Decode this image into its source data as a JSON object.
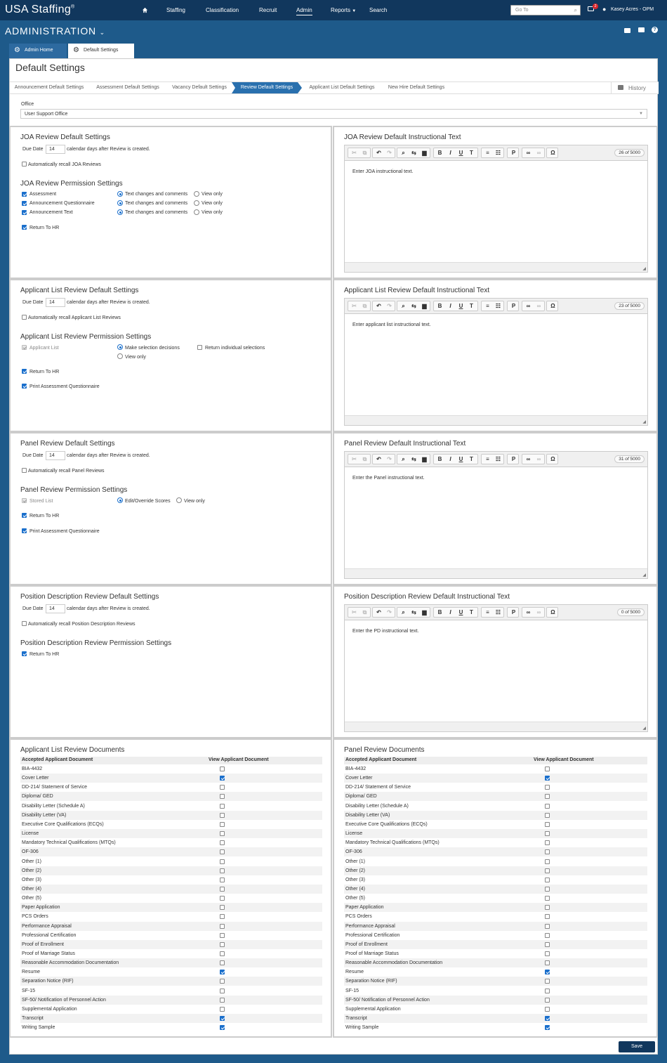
{
  "topnav": {
    "brand": "USA Staffing",
    "brand_mark": "®",
    "items": [
      "Staffing",
      "Classification",
      "Recruit",
      "Admin",
      "Reports",
      "Search"
    ],
    "goto_placeholder": "Go To",
    "notify_count": "2",
    "user": "Kasey Acres - OPM"
  },
  "admin": {
    "title": "ADMINISTRATION"
  },
  "tabs": [
    "Admin Home",
    "Default Settings"
  ],
  "page": {
    "title": "Default Settings"
  },
  "breadcrumbs": [
    "Announcement Default Settings",
    "Assessment Default Settings",
    "Vacancy Default Settings",
    "Review Default Settings",
    "Applicant List Default Settings",
    "New Hire Default Settings"
  ],
  "history_label": "History",
  "office": {
    "label": "Office",
    "value": "User Support Office"
  },
  "common": {
    "due_date": "Due Date",
    "days_after": "calendar days after Review is created.",
    "text_changes": "Text changes and comments",
    "view_only": "View only",
    "return_to_hr": "Return To HR",
    "print_aq": "Print Assessment Questionnaire"
  },
  "joa": {
    "title": "JOA Review Default Settings",
    "days": "14",
    "recall": "Automatically recall JOA Reviews",
    "perm_title": "JOA Review Permission Settings",
    "perm_items": [
      "Assessment",
      "Announcement Questionnaire",
      "Announcement Text"
    ],
    "text_title": "JOA Review Default Instructional Text",
    "count": "26",
    "max": "5000",
    "text": "Enter JOA instructional text."
  },
  "applist": {
    "title": "Applicant List Review Default Settings",
    "days": "14",
    "recall": "Automatically recall Applicant List Reviews",
    "perm_title": "Applicant List Review Permission Settings",
    "perm_item": "Applicant List",
    "make_selection": "Make selection decisions",
    "return_individual": "Return individual selections",
    "view_only": "View only",
    "text_title": "Applicant List Review Default Instructional Text",
    "count": "23",
    "max": "5000",
    "text": "Enter applicant list instructional text."
  },
  "panel": {
    "title": "Panel Review Default Settings",
    "days": "14",
    "recall": "Automatically recall Panel Reviews",
    "perm_title": "Panel Review Permission Settings",
    "perm_item": "Stored List",
    "edit_override": "Edit/Override Scores",
    "view_only": "View only",
    "text_title": "Panel Review Default Instructional Text",
    "count": "31",
    "max": "5000",
    "text": "Enter the Panel instructional text."
  },
  "pd": {
    "title": "Position Description Review Default Settings",
    "days": "14",
    "recall": "Automatically recall Position Description Reviews",
    "perm_title": "Position Description Review Permission Settings",
    "text_title": "Position Description Review Default Instructional Text",
    "count": "0",
    "max": "5000",
    "text": "Enter the PD instructional text."
  },
  "docs": {
    "applist_title": "Applicant List Review Documents",
    "panel_title": "Panel Review Documents",
    "col_accepted": "Accepted Applicant Document",
    "col_view": "View Applicant Document",
    "items": [
      "BIA-4432",
      "Cover Letter",
      "DD-214/ Statement of Service",
      "Diploma/ GED",
      "Disability Letter (Schedule A)",
      "Disability Letter (VA)",
      "Executive Core Qualifications (ECQs)",
      "License",
      "Mandatory Technical Qualifications (MTQs)",
      "OF-306",
      "Other (1)",
      "Other (2)",
      "Other (3)",
      "Other (4)",
      "Other (5)",
      "Paper Application",
      "PCS Orders",
      "Performance Appraisal",
      "Professional Certification",
      "Proof of Enrollment",
      "Proof of Marriage Status",
      "Reasonable Accommodation Documentation",
      "Resume",
      "Separation Notice (RIF)",
      "SF-15",
      "SF-50/ Notification of Personnel Action",
      "Supplemental Application",
      "Transcript",
      "Writing Sample"
    ],
    "checked": [
      false,
      true,
      false,
      false,
      false,
      false,
      false,
      false,
      false,
      false,
      false,
      false,
      false,
      false,
      false,
      false,
      false,
      false,
      false,
      false,
      false,
      false,
      true,
      false,
      false,
      false,
      false,
      true,
      true
    ]
  },
  "save_label": "Save",
  "colors": {
    "navy": "#11375d",
    "blue": "#1e5a8a",
    "accent": "#2970ae",
    "check": "#1a6fcc"
  }
}
